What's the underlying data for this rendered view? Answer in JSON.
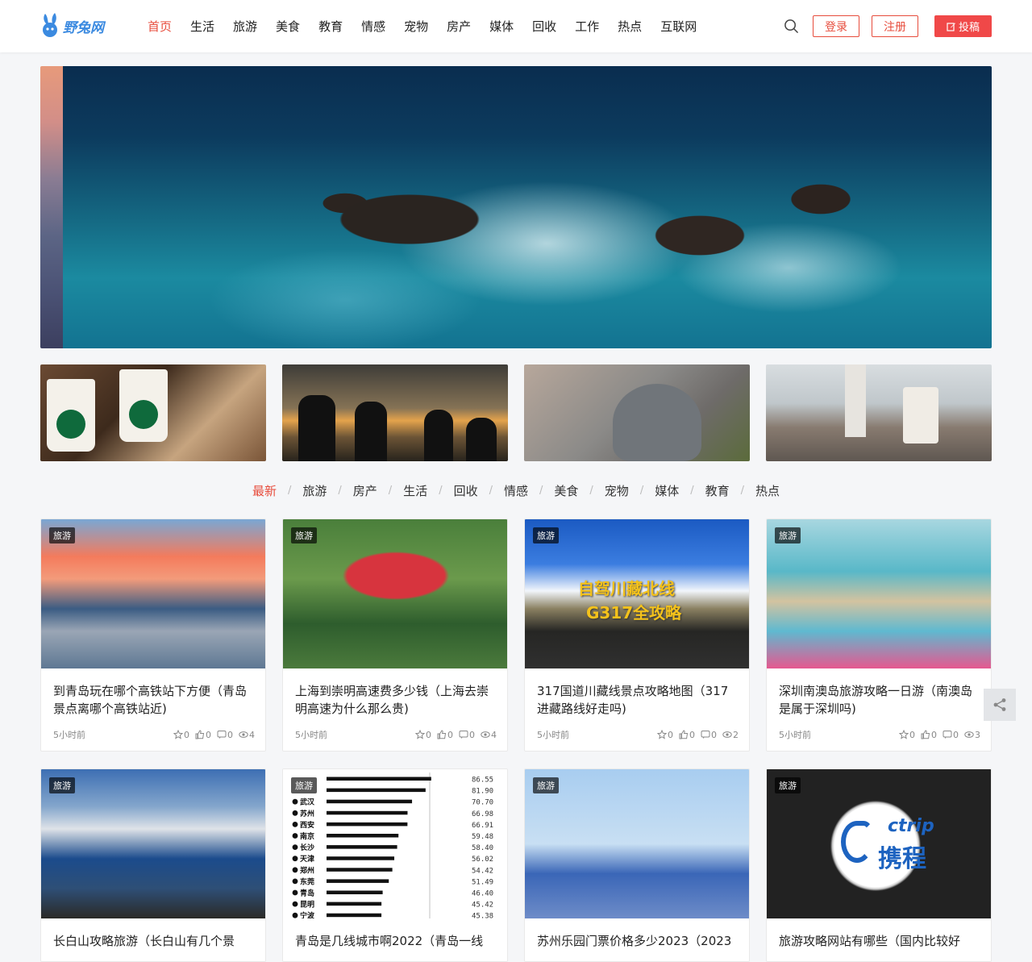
{
  "brand": {
    "name": "野兔网"
  },
  "nav": [
    {
      "label": "首页",
      "active": true
    },
    {
      "label": "生活"
    },
    {
      "label": "旅游"
    },
    {
      "label": "美食"
    },
    {
      "label": "教育"
    },
    {
      "label": "情感"
    },
    {
      "label": "宠物"
    },
    {
      "label": "房产"
    },
    {
      "label": "媒体"
    },
    {
      "label": "回收"
    },
    {
      "label": "工作"
    },
    {
      "label": "热点"
    },
    {
      "label": "互联网"
    }
  ],
  "header": {
    "login": "登录",
    "register": "注册",
    "post": "投稿"
  },
  "category_tabs": [
    {
      "label": "最新",
      "active": true
    },
    {
      "label": "旅游"
    },
    {
      "label": "房产"
    },
    {
      "label": "生活"
    },
    {
      "label": "回收"
    },
    {
      "label": "情感"
    },
    {
      "label": "美食"
    },
    {
      "label": "宠物"
    },
    {
      "label": "媒体"
    },
    {
      "label": "教育"
    },
    {
      "label": "热点"
    }
  ],
  "articles": [
    {
      "tag": "旅游",
      "title": "到青岛玩在哪个高铁站下方便（青岛景点离哪个高铁站近)",
      "time": "5小时前",
      "favorites": "0",
      "likes": "0",
      "comments": "0",
      "views": "4"
    },
    {
      "tag": "旅游",
      "title": "上海到崇明高速费多少钱（上海去崇明高速为什么那么贵)",
      "time": "5小时前",
      "favorites": "0",
      "likes": "0",
      "comments": "0",
      "views": "4"
    },
    {
      "tag": "旅游",
      "title": "317国道川藏线景点攻略地图（317进藏路线好走吗)",
      "time": "5小时前",
      "favorites": "0",
      "likes": "0",
      "comments": "0",
      "views": "2"
    },
    {
      "tag": "旅游",
      "title": "深圳南澳岛旅游攻略一日游（南澳岛是属于深圳吗)",
      "time": "5小时前",
      "favorites": "0",
      "likes": "0",
      "comments": "0",
      "views": "3"
    },
    {
      "tag": "旅游",
      "title": "长白山攻略旅游（长白山有几个景"
    },
    {
      "tag": "旅游",
      "title": "青岛是几线城市啊2022（青岛一线"
    },
    {
      "tag": "旅游",
      "title": "苏州乐园门票价格多少2023（2023"
    },
    {
      "tag": "旅游",
      "title": "旅游攻略网站有哪些（国内比较好"
    }
  ],
  "image_texts": {
    "road_overlay_1": "自驾川藏北线",
    "road_overlay_2": "G317全攻略",
    "ctrip_logo": "ctrip",
    "ctrip_cn": "携程"
  },
  "chart_data": {
    "type": "bar",
    "categories": [
      "",
      "",
      "武汉",
      "苏州",
      "西安",
      "南京",
      "长沙",
      "天津",
      "郑州",
      "东莞",
      "青岛",
      "昆明",
      "宁波"
    ],
    "values": [
      86.55,
      81.9,
      70.7,
      66.98,
      66.91,
      59.48,
      58.4,
      56.02,
      54.42,
      51.49,
      46.4,
      45.42,
      45.38
    ],
    "value_labels": [
      "86.55",
      "81.90",
      "70.70",
      "66.98",
      "66.91",
      "59.48",
      "58.40",
      "56.02",
      "54.42",
      "51.49",
      "46.40",
      "45.42",
      "45.38"
    ],
    "xlim": [
      0,
      100
    ]
  },
  "colors": {
    "accent": "#e74c3c",
    "post_button": "#f04848"
  }
}
